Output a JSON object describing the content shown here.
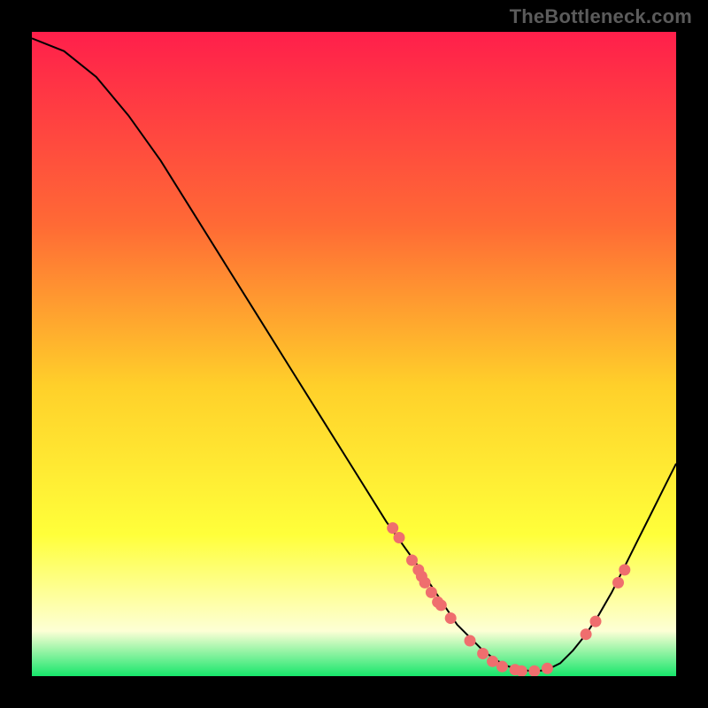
{
  "watermark": "TheBottleneck.com",
  "colors": {
    "background": "#000000",
    "gradient_top": "#ff1f4b",
    "gradient_mid1": "#ff6a35",
    "gradient_mid2": "#ffd02a",
    "gradient_mid3": "#ffff3a",
    "gradient_low": "#fdffd5",
    "gradient_bottom": "#17e66b",
    "curve": "#000000",
    "dots": "#ef6e6e"
  },
  "chart_data": {
    "type": "line",
    "title": "",
    "xlabel": "",
    "ylabel": "",
    "xlim": [
      0,
      100
    ],
    "ylim": [
      0,
      100
    ],
    "grid": false,
    "legend": false,
    "x": [
      0,
      5,
      10,
      15,
      20,
      25,
      30,
      35,
      40,
      45,
      50,
      55,
      60,
      62,
      64,
      66,
      68,
      70,
      72,
      74,
      76,
      78,
      80,
      82,
      84,
      86,
      88,
      90,
      92,
      94,
      96,
      98,
      100
    ],
    "values": [
      99,
      97,
      93,
      87,
      80,
      72,
      64,
      56,
      48,
      40,
      32,
      24,
      17,
      14,
      11,
      8,
      6,
      4,
      2.5,
      1.5,
      1,
      0.7,
      1,
      2,
      4,
      6.5,
      9.5,
      13,
      17,
      21,
      25,
      29,
      33
    ],
    "dots": [
      {
        "x": 56,
        "y": 23
      },
      {
        "x": 57,
        "y": 21.5
      },
      {
        "x": 59,
        "y": 18
      },
      {
        "x": 60,
        "y": 16.5
      },
      {
        "x": 60.5,
        "y": 15.5
      },
      {
        "x": 61,
        "y": 14.5
      },
      {
        "x": 62,
        "y": 13
      },
      {
        "x": 63,
        "y": 11.5
      },
      {
        "x": 63.5,
        "y": 11
      },
      {
        "x": 65,
        "y": 9
      },
      {
        "x": 68,
        "y": 5.5
      },
      {
        "x": 70,
        "y": 3.5
      },
      {
        "x": 71.5,
        "y": 2.3
      },
      {
        "x": 73,
        "y": 1.5
      },
      {
        "x": 75,
        "y": 1
      },
      {
        "x": 76,
        "y": 0.8
      },
      {
        "x": 78,
        "y": 0.8
      },
      {
        "x": 80,
        "y": 1.2
      },
      {
        "x": 86,
        "y": 6.5
      },
      {
        "x": 87.5,
        "y": 8.5
      },
      {
        "x": 91,
        "y": 14.5
      },
      {
        "x": 92,
        "y": 16.5
      }
    ]
  }
}
